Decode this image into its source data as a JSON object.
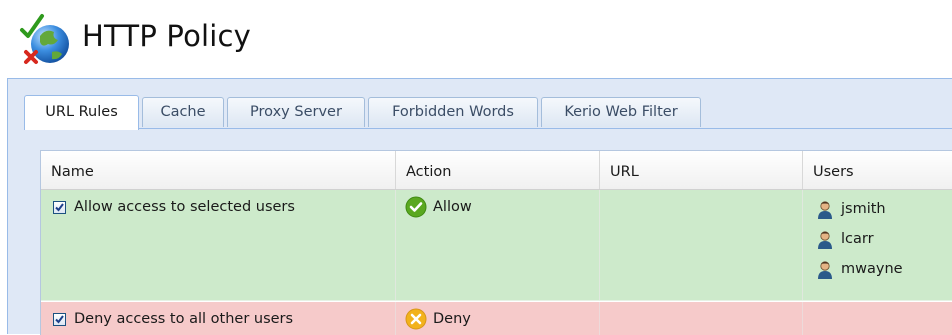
{
  "page": {
    "title": "HTTP Policy"
  },
  "tabs": [
    {
      "label": "URL Rules",
      "active": true
    },
    {
      "label": "Cache"
    },
    {
      "label": "Proxy Server"
    },
    {
      "label": "Forbidden Words"
    },
    {
      "label": "Kerio Web Filter"
    }
  ],
  "grid": {
    "columns": [
      "Name",
      "Action",
      "URL",
      "Users"
    ],
    "rows": [
      {
        "checked": true,
        "name": "Allow access to selected users",
        "action": "Allow",
        "action_icon": "allow-check-icon",
        "url": "",
        "users": [
          "jsmith",
          "lcarr",
          "mwayne"
        ],
        "row_color": "#cdeacb"
      },
      {
        "checked": true,
        "name": "Deny access to all other users",
        "action": "Deny",
        "action_icon": "deny-x-icon",
        "url": "",
        "users": [],
        "row_color": "#f6caca"
      }
    ]
  },
  "colors": {
    "panel_bg": "#dfe8f6",
    "allow_row": "#cdeacb",
    "deny_row": "#f6caca",
    "allow_icon": "#5aa820",
    "deny_icon": "#f2b21c"
  }
}
